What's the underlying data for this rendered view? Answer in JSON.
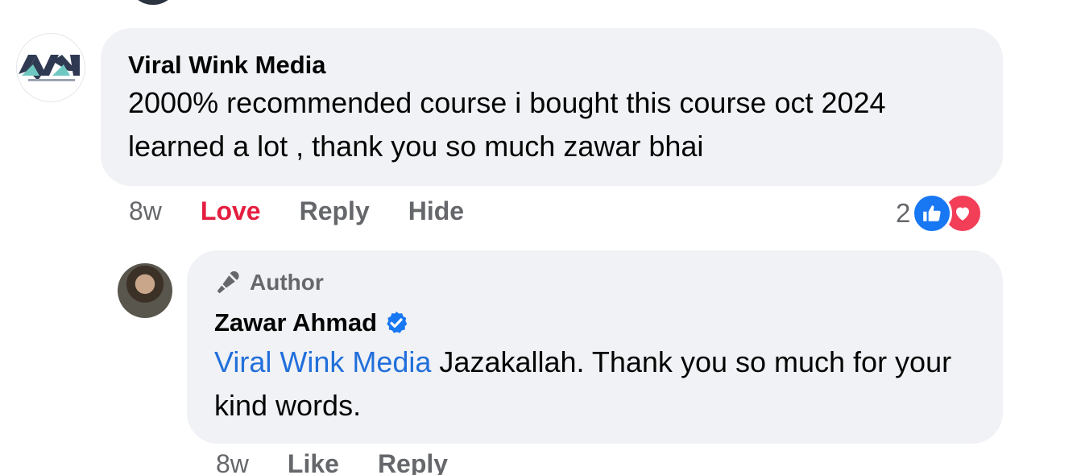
{
  "comment": {
    "author": "Viral Wink Media",
    "text": "2000% recommended course i bought this course oct 2024 learned a lot , thank you so much zawar bhai",
    "time": "8w",
    "actions": {
      "love": "Love",
      "reply": "Reply",
      "hide": "Hide"
    },
    "reaction_count": "2",
    "reactions": [
      "like-icon",
      "love-icon"
    ]
  },
  "reply": {
    "badge": "Author",
    "author": "Zawar Ahmad",
    "verified": true,
    "mention": "Viral Wink Media",
    "text": " Jazakallah. Thank you so much for your kind words.",
    "time": "8w",
    "actions": {
      "like": "Like",
      "reply": "Reply"
    }
  },
  "colors": {
    "bubble": "#f0f2f5",
    "love": "#e41e3f",
    "link": "#216fdb",
    "secondary_text": "#65676b",
    "like_react": "#1877f2",
    "love_react": "#f33e58"
  }
}
